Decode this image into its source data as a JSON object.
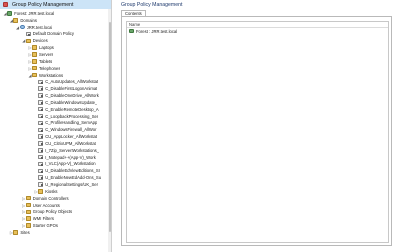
{
  "tree": {
    "header": "Group Policy Management",
    "rows": [
      {
        "label": "Forest: JRR.test.local",
        "depth": 1,
        "expander": "◢",
        "icon": "forest",
        "icon_name": "forest-icon"
      },
      {
        "label": "Domains",
        "depth": 2,
        "expander": "◢",
        "icon": "folder",
        "icon_name": "folder-icon"
      },
      {
        "label": "JRR.test.local",
        "depth": 3,
        "expander": "◢",
        "icon": "domain",
        "icon_name": "domain-icon"
      },
      {
        "label": "Default Domain Policy",
        "depth": 4,
        "expander": "",
        "icon": "link",
        "icon_name": "gpo-link-icon"
      },
      {
        "label": "Devices",
        "depth": 4,
        "expander": "◢",
        "icon": "folder",
        "icon_name": "ou-folder-icon"
      },
      {
        "label": "Laptops",
        "depth": 5,
        "expander": "▷",
        "icon": "folder",
        "icon_name": "ou-folder-icon"
      },
      {
        "label": "Servers",
        "depth": 5,
        "expander": "▷",
        "icon": "folder",
        "icon_name": "ou-folder-icon"
      },
      {
        "label": "Tablets",
        "depth": 5,
        "expander": "▷",
        "icon": "folder",
        "icon_name": "ou-folder-icon"
      },
      {
        "label": "Telephones",
        "depth": 5,
        "expander": "▷",
        "icon": "folder",
        "icon_name": "ou-folder-icon"
      },
      {
        "label": "Workstations",
        "depth": 5,
        "expander": "◢",
        "icon": "folder",
        "icon_name": "ou-folder-icon"
      },
      {
        "label": "C_AutoUpdates_AllWorkstat",
        "depth": 6,
        "expander": "",
        "icon": "link",
        "icon_name": "gpo-link-icon"
      },
      {
        "label": "C_DisableFirstLogonAnimat",
        "depth": 6,
        "expander": "",
        "icon": "link",
        "icon_name": "gpo-link-icon"
      },
      {
        "label": "C_DisableOneDrive_AllWork",
        "depth": 6,
        "expander": "",
        "icon": "link",
        "icon_name": "gpo-link-icon"
      },
      {
        "label": "C_DisableWindowsUpdate_",
        "depth": 6,
        "expander": "",
        "icon": "link",
        "icon_name": "gpo-link-icon"
      },
      {
        "label": "C_EnableRemoteDesktop_A",
        "depth": 6,
        "expander": "",
        "icon": "link",
        "icon_name": "gpo-link-icon"
      },
      {
        "label": "C_LoopbackProcessing_Ser",
        "depth": 6,
        "expander": "",
        "icon": "link",
        "icon_name": "gpo-link-icon"
      },
      {
        "label": "C_ProfileHandling_SemApp",
        "depth": 6,
        "expander": "",
        "icon": "link",
        "icon_name": "gpo-link-icon"
      },
      {
        "label": "C_WindowsFirewall_AllWor",
        "depth": 6,
        "expander": "",
        "icon": "link",
        "icon_name": "gpo-link-icon"
      },
      {
        "label": "CU_AppLocker_AllWorkstat",
        "depth": 6,
        "expander": "",
        "icon": "link",
        "icon_name": "gpo-link-icon"
      },
      {
        "label": "CU_CitrixUPM_AllWorkstat",
        "depth": 6,
        "expander": "",
        "icon": "link",
        "icon_name": "gpo-link-icon"
      },
      {
        "label": "I_7Zip_ServerIWorkstations_",
        "depth": 6,
        "expander": "",
        "icon": "link",
        "icon_name": "gpo-link-icon"
      },
      {
        "label": "I_Notepad++(App-V)_Work",
        "depth": 6,
        "expander": "",
        "icon": "link",
        "icon_name": "gpo-link-icon"
      },
      {
        "label": "I_VLC(App-V)_Workstation",
        "depth": 6,
        "expander": "",
        "icon": "link",
        "icon_name": "gpo-link-icon"
      },
      {
        "label": "U_DisableEdViewEditions_SI",
        "depth": 6,
        "expander": "",
        "icon": "link",
        "icon_name": "gpo-link-icon"
      },
      {
        "label": "U_EnableNewEdAdd-Ons_Su",
        "depth": 6,
        "expander": "",
        "icon": "link",
        "icon_name": "gpo-link-icon"
      },
      {
        "label": "U_RegionalSettings/UK_Ser",
        "depth": 6,
        "expander": "",
        "icon": "link",
        "icon_name": "gpo-link-icon"
      },
      {
        "label": "Kiosks",
        "depth": 6,
        "expander": "▷",
        "icon": "folder",
        "icon_name": "ou-folder-icon"
      },
      {
        "label": "Domain Controllers",
        "depth": 4,
        "expander": "▷",
        "icon": "folder",
        "icon_name": "ou-folder-icon"
      },
      {
        "label": "User Accounts",
        "depth": 4,
        "expander": "▷",
        "icon": "folder",
        "icon_name": "ou-folder-icon"
      },
      {
        "label": "Group Policy Objects",
        "depth": 4,
        "expander": "▷",
        "icon": "folder",
        "icon_name": "folder-icon"
      },
      {
        "label": "WMI Filters",
        "depth": 4,
        "expander": "▷",
        "icon": "folder",
        "icon_name": "folder-icon"
      },
      {
        "label": "Starter GPOs",
        "depth": 4,
        "expander": "▷",
        "icon": "folder",
        "icon_name": "folder-icon"
      },
      {
        "label": "Sites",
        "depth": 2,
        "expander": "▷",
        "icon": "folder",
        "icon_name": "sites-icon"
      }
    ]
  },
  "content": {
    "title": "Group Policy Management",
    "tab": "Contents",
    "column_header": "Name",
    "rows": [
      {
        "label": "Forest : JRR.test.local"
      }
    ]
  }
}
